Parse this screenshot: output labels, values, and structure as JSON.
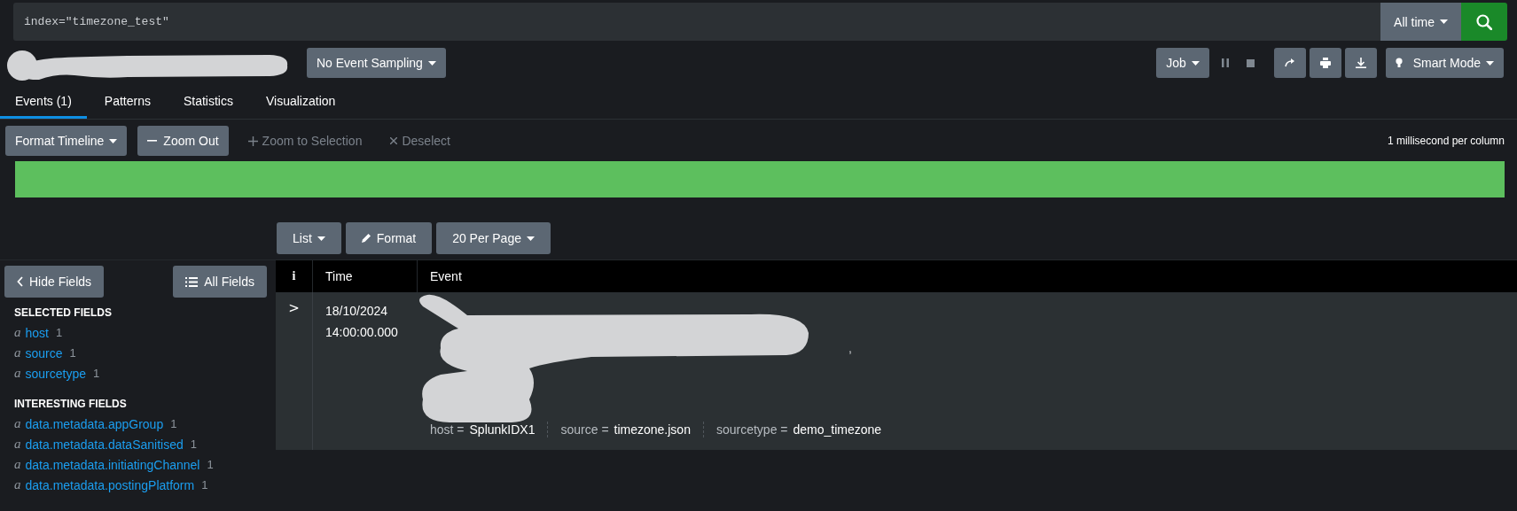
{
  "search": {
    "query": "index=\"timezone_test\"",
    "time_range": "All time"
  },
  "job_bar": {
    "sampling": "No Event Sampling",
    "job": "Job",
    "mode": "Smart Mode"
  },
  "tabs": [
    {
      "label": "Events (1)",
      "selected": true
    },
    {
      "label": "Patterns",
      "selected": false
    },
    {
      "label": "Statistics",
      "selected": false
    },
    {
      "label": "Visualization",
      "selected": false
    }
  ],
  "timeline": {
    "buttons": [
      {
        "label": "Format Timeline",
        "kind": "dropdown",
        "disabled": false
      },
      {
        "label": "Zoom Out",
        "kind": "minus",
        "disabled": false
      },
      {
        "label": "Zoom to Selection",
        "kind": "plus",
        "disabled": true
      },
      {
        "label": "Deselect",
        "kind": "cross",
        "disabled": true
      }
    ],
    "scale": "1 millisecond per column"
  },
  "results_toolbar": [
    {
      "label": "List",
      "kind": "dropdown"
    },
    {
      "label": "Format",
      "kind": "edit"
    },
    {
      "label": "20 Per Page",
      "kind": "dropdown"
    }
  ],
  "sidebar": {
    "hide_fields": "Hide Fields",
    "all_fields": "All Fields",
    "sections": [
      {
        "title": "SELECTED FIELDS",
        "fields": [
          {
            "type": "a",
            "name": "host",
            "count": "1"
          },
          {
            "type": "a",
            "name": "source",
            "count": "1"
          },
          {
            "type": "a",
            "name": "sourcetype",
            "count": "1"
          }
        ]
      },
      {
        "title": "INTERESTING FIELDS",
        "fields": [
          {
            "type": "a",
            "name": "data.metadata.appGroup",
            "count": "1"
          },
          {
            "type": "a",
            "name": "data.metadata.dataSanitised",
            "count": "1"
          },
          {
            "type": "a",
            "name": "data.metadata.initiatingChannel",
            "count": "1"
          },
          {
            "type": "a",
            "name": "data.metadata.postingPlatform",
            "count": "1"
          }
        ]
      }
    ]
  },
  "table": {
    "columns": [
      "i",
      "Time",
      "Event"
    ],
    "rows": [
      {
        "expand": ">",
        "time": [
          "18/10/2024",
          "14:00:00.000"
        ],
        "event": ",",
        "meta": [
          {
            "key": "host =",
            "value": "SplunkIDX1"
          },
          {
            "key": "source =",
            "value": "timezone.json"
          },
          {
            "key": "sourcetype =",
            "value": "demo_timezone"
          }
        ]
      }
    ]
  }
}
